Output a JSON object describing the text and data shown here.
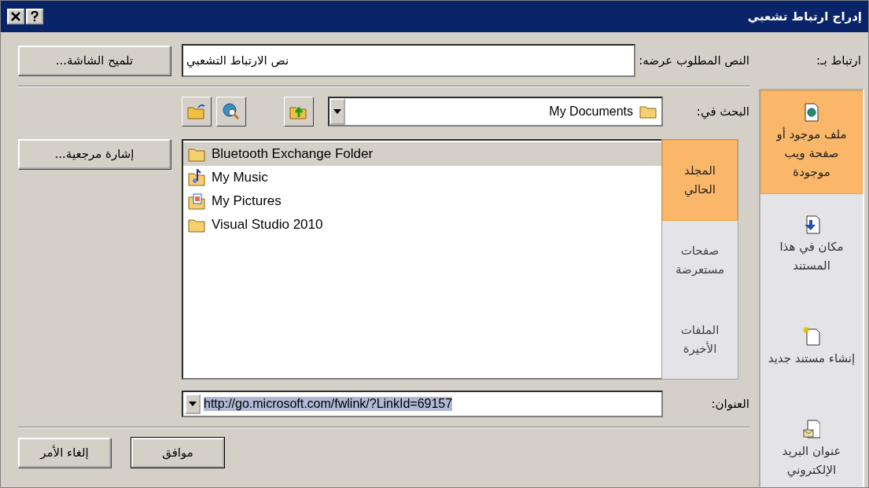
{
  "window": {
    "title": "إدراج ارتباط تشعبي"
  },
  "link_to": {
    "label": "ارتباط بـ:",
    "items": [
      {
        "label": "ملف موجود أو صفحة ويب موجودة",
        "kind": "file",
        "selected": true
      },
      {
        "label": "مكان في هذا المستند",
        "kind": "place",
        "selected": false
      },
      {
        "label": "إنشاء مستند جديد",
        "kind": "new",
        "selected": false
      },
      {
        "label": "عنوان البريد الإلكتروني",
        "kind": "mail",
        "selected": false
      }
    ]
  },
  "display_text": {
    "label": "النص المطلوب عرضه:",
    "value": "نص الارتباط التشعبي"
  },
  "screentip_button": "تلميح الشاشة...",
  "look_in": {
    "label": "البحث في:",
    "value": "My Documents"
  },
  "places": [
    {
      "label": "المجلد الحالي",
      "selected": true
    },
    {
      "label": "صفحات مستعرضة",
      "selected": false
    },
    {
      "label": "الملفات الأخيرة",
      "selected": false
    }
  ],
  "files": [
    {
      "name": "Bluetooth Exchange Folder",
      "kind": "folder",
      "selected": true
    },
    {
      "name": "My Music",
      "kind": "music",
      "selected": false
    },
    {
      "name": "My Pictures",
      "kind": "pictures",
      "selected": false
    },
    {
      "name": "Visual Studio 2010",
      "kind": "folder",
      "selected": false
    }
  ],
  "bookmark_button": "إشارة مرجعية...",
  "address": {
    "label": "العنوان:",
    "value": "http://go.microsoft.com/fwlink/?LinkId=69157",
    "selected": true
  },
  "buttons": {
    "ok": "موافق",
    "cancel": "إلغاء الأمر"
  }
}
